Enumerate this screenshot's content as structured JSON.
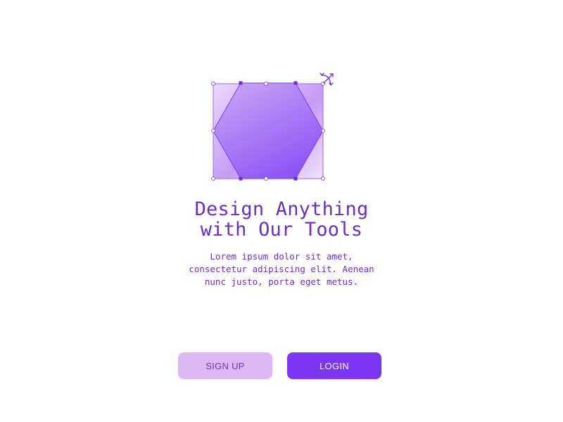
{
  "hero": {
    "title_line1": "Design Anything",
    "title_line2": "with Our Tools",
    "body_line1": "Lorem ipsum dolor sit amet,",
    "body_line2": "consectetur adipiscing elit. Aenean",
    "body_line3": "nunc justo, porta eget metus."
  },
  "actions": {
    "signup_label": "SIGN UP",
    "login_label": "LOGIN"
  },
  "illustration": {
    "icon": "hexagon-shape-editor-illustration",
    "rotate_icon": "rotate-arrows-icon"
  },
  "colors": {
    "accent": "#7b35f3",
    "accent_light": "#dcb8f7",
    "text": "#6a2fc9"
  }
}
